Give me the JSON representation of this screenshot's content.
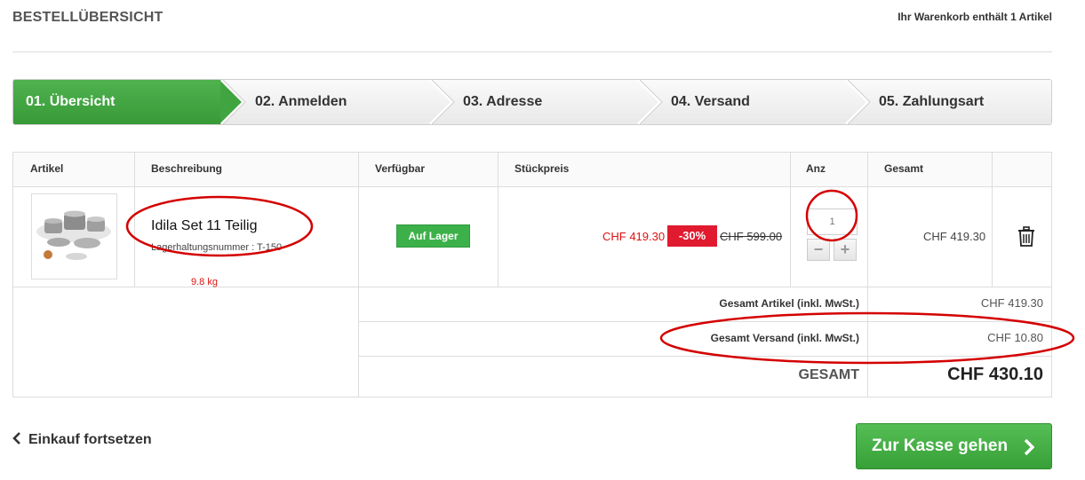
{
  "header": {
    "title": "BESTELLÜBERSICHT",
    "cart_count": "Ihr Warenkorb enthält 1 Artikel"
  },
  "steps": [
    {
      "label": "01. Übersicht",
      "active": true
    },
    {
      "label": "02. Anmelden",
      "active": false
    },
    {
      "label": "03. Adresse",
      "active": false
    },
    {
      "label": "04. Versand",
      "active": false
    },
    {
      "label": "05. Zahlungsart",
      "active": false
    }
  ],
  "table": {
    "headers": {
      "article": "Artikel",
      "description": "Beschreibung",
      "availability": "Verfügbar",
      "unit_price": "Stückpreis",
      "qty": "Anz",
      "total": "Gesamt"
    },
    "item": {
      "name": "Idila Set 11 Teilig",
      "sku": "Lagerhaltungsnummer : T-150",
      "weight": "9.8 kg",
      "availability": "Auf Lager",
      "price": "CHF 419.30",
      "discount": "-30%",
      "old_price": "CHF 599.00",
      "quantity": "1",
      "line_total": "CHF 419.30",
      "minus": "−",
      "plus": "+",
      "thumbnail_icon": "cookware-set-image",
      "delete_icon": "trash-icon"
    },
    "summary": {
      "articles_label": "Gesamt Artikel (inkl. MwSt.)",
      "articles_value": "CHF 419.30",
      "shipping_label": "Gesamt Versand (inkl. MwSt.)",
      "shipping_value": "CHF 10.80",
      "grand_label": "GESAMT",
      "grand_value": "CHF 430.10"
    }
  },
  "footer": {
    "back_link": "Einkauf fortsetzen",
    "checkout_button": "Zur Kasse gehen"
  },
  "colors": {
    "accent_green": "#40a540",
    "discount_red": "#e01b2f",
    "annotation_red": "#d40000"
  }
}
